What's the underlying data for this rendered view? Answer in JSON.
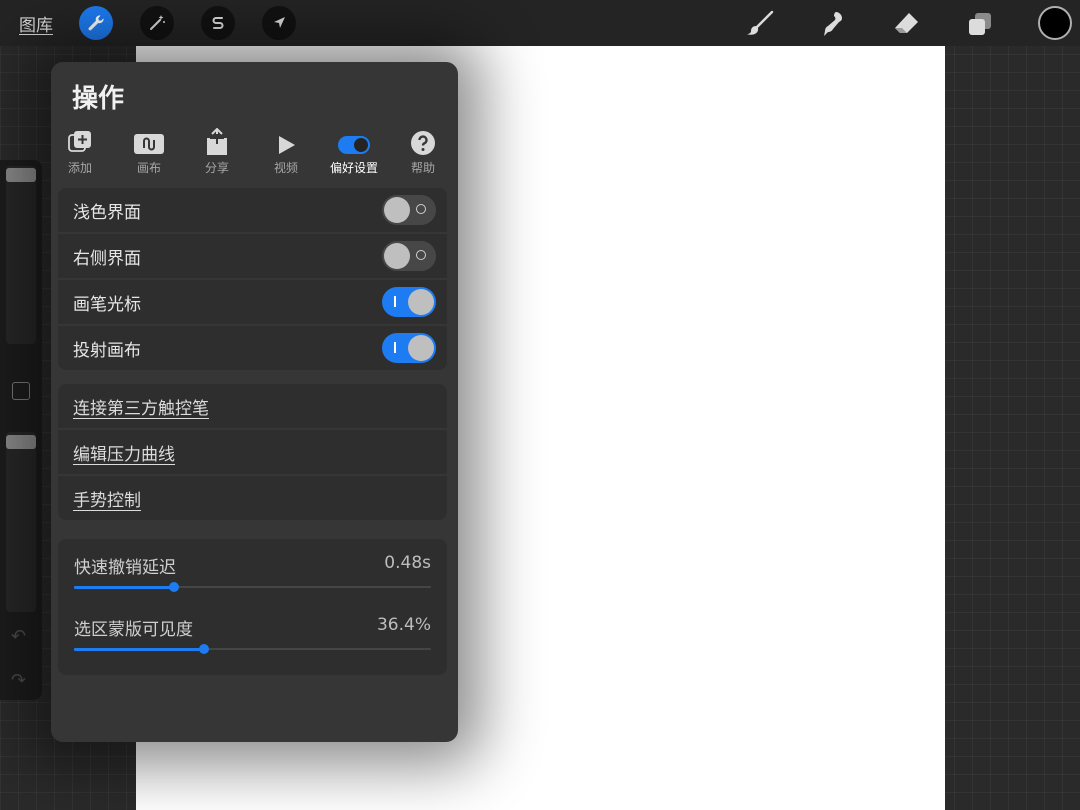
{
  "topbar": {
    "gallery_label": "图库",
    "left_tools": [
      "wrench-icon",
      "magic-wand-icon",
      "selection-s-icon",
      "transform-arrow-icon"
    ],
    "right_tools": [
      "brush-icon",
      "smudge-icon",
      "eraser-icon",
      "layers-icon"
    ],
    "color": "#000000"
  },
  "panel": {
    "title": "操作",
    "tabs": [
      {
        "label": "添加",
        "icon": "add-icon"
      },
      {
        "label": "画布",
        "icon": "canvas-icon"
      },
      {
        "label": "分享",
        "icon": "share-icon"
      },
      {
        "label": "视频",
        "icon": "video-play-icon"
      },
      {
        "label": "偏好设置",
        "icon": "toggle-prefs-icon",
        "active": true
      },
      {
        "label": "帮助",
        "icon": "help-icon"
      }
    ],
    "toggles": [
      {
        "label": "浅色界面",
        "on": false
      },
      {
        "label": "右侧界面",
        "on": false
      },
      {
        "label": "画笔光标",
        "on": true
      },
      {
        "label": "投射画布",
        "on": true
      }
    ],
    "links": [
      {
        "label": "连接第三方触控笔"
      },
      {
        "label": "编辑压力曲线"
      },
      {
        "label": "手势控制"
      }
    ],
    "sliders": [
      {
        "label": "快速撤销延迟",
        "value_text": "0.48s",
        "fraction": 0.28
      },
      {
        "label": "选区蒙版可见度",
        "value_text": "36.4%",
        "fraction": 0.364
      }
    ]
  },
  "colors": {
    "accent": "#1d7cf2",
    "panel_bg": "#363636",
    "canvas": "#ffffff"
  }
}
